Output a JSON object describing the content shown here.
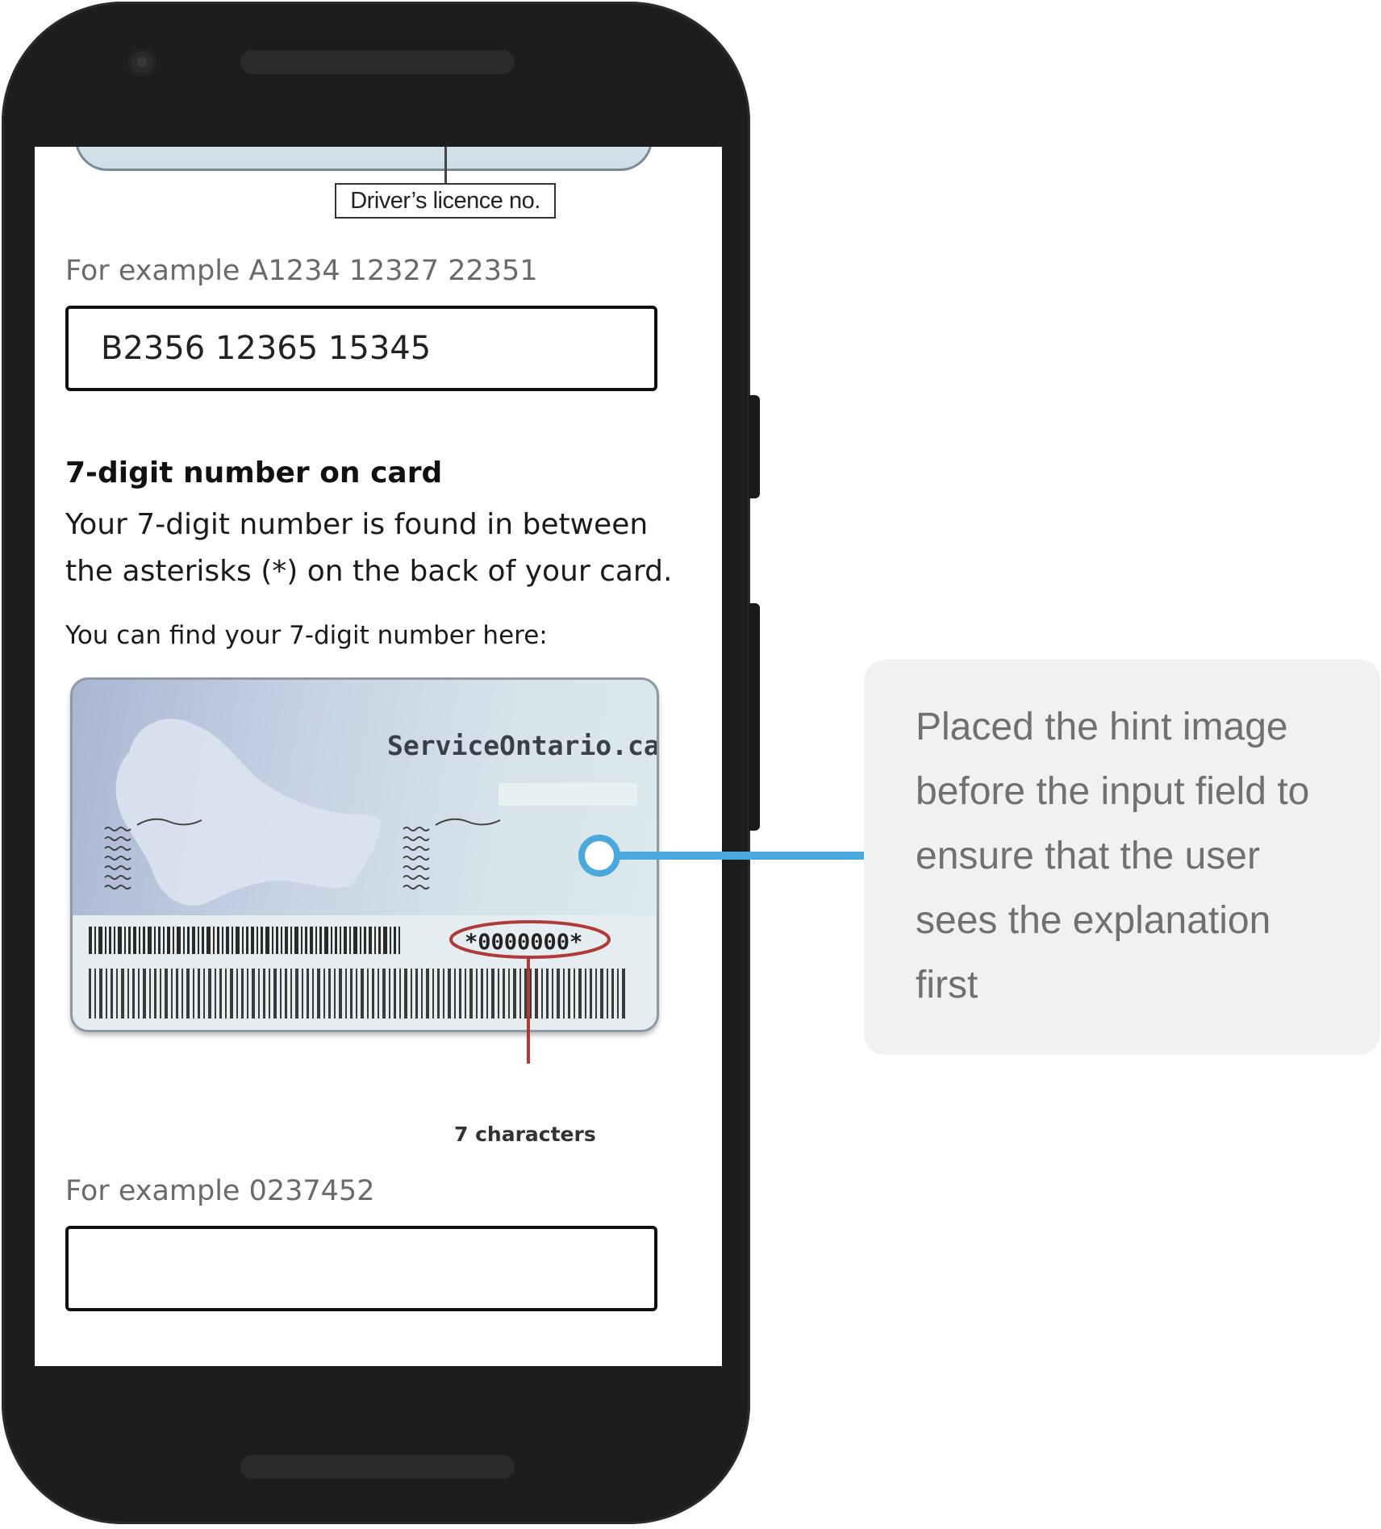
{
  "screen": {
    "licence_label": "Driver’s licence no.",
    "licence_example": "For example A1234 12327 22351",
    "licence_value": "B2356 12365 15345",
    "section_heading": "7-digit number on card",
    "section_body": "Your 7-digit number is found in between the asterisks (*) on the back of your card.",
    "find_here": "You can find your 7-digit number here:",
    "card": {
      "brand": "ServiceOntario.ca",
      "number": "*0000000*",
      "characters_label": "7 characters"
    },
    "number_example": "For example 0237452",
    "number_value": ""
  },
  "annotation": {
    "text": "Placed the hint image before the input field to ensure that the user sees the explanation first",
    "accent_color": "#4aa8dc"
  }
}
